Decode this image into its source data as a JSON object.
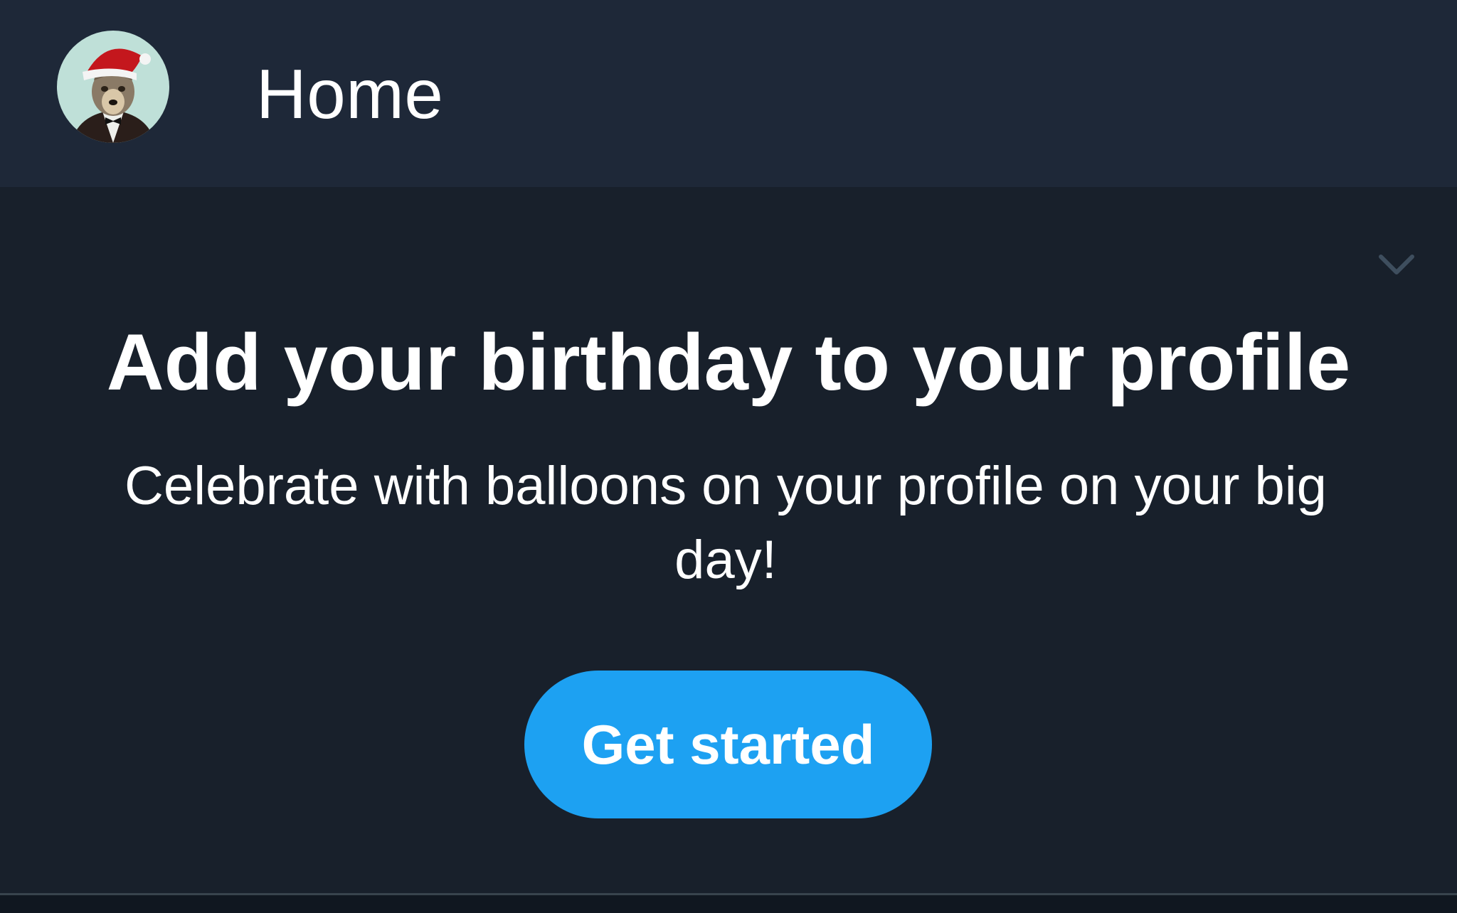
{
  "header": {
    "title": "Home",
    "avatar_icon": "profile-avatar-wolf-santa-hat"
  },
  "prompt_card": {
    "title": "Add your birthday to your profile",
    "subtitle": "Celebrate with balloons on your profile on your big day!",
    "cta_label": "Get started",
    "dismiss_icon": "chevron-down-icon"
  },
  "colors": {
    "header_bg": "#1e2838",
    "card_bg": "#18202b",
    "accent": "#1da1f2",
    "text": "#ffffff",
    "divider": "#38444d"
  }
}
